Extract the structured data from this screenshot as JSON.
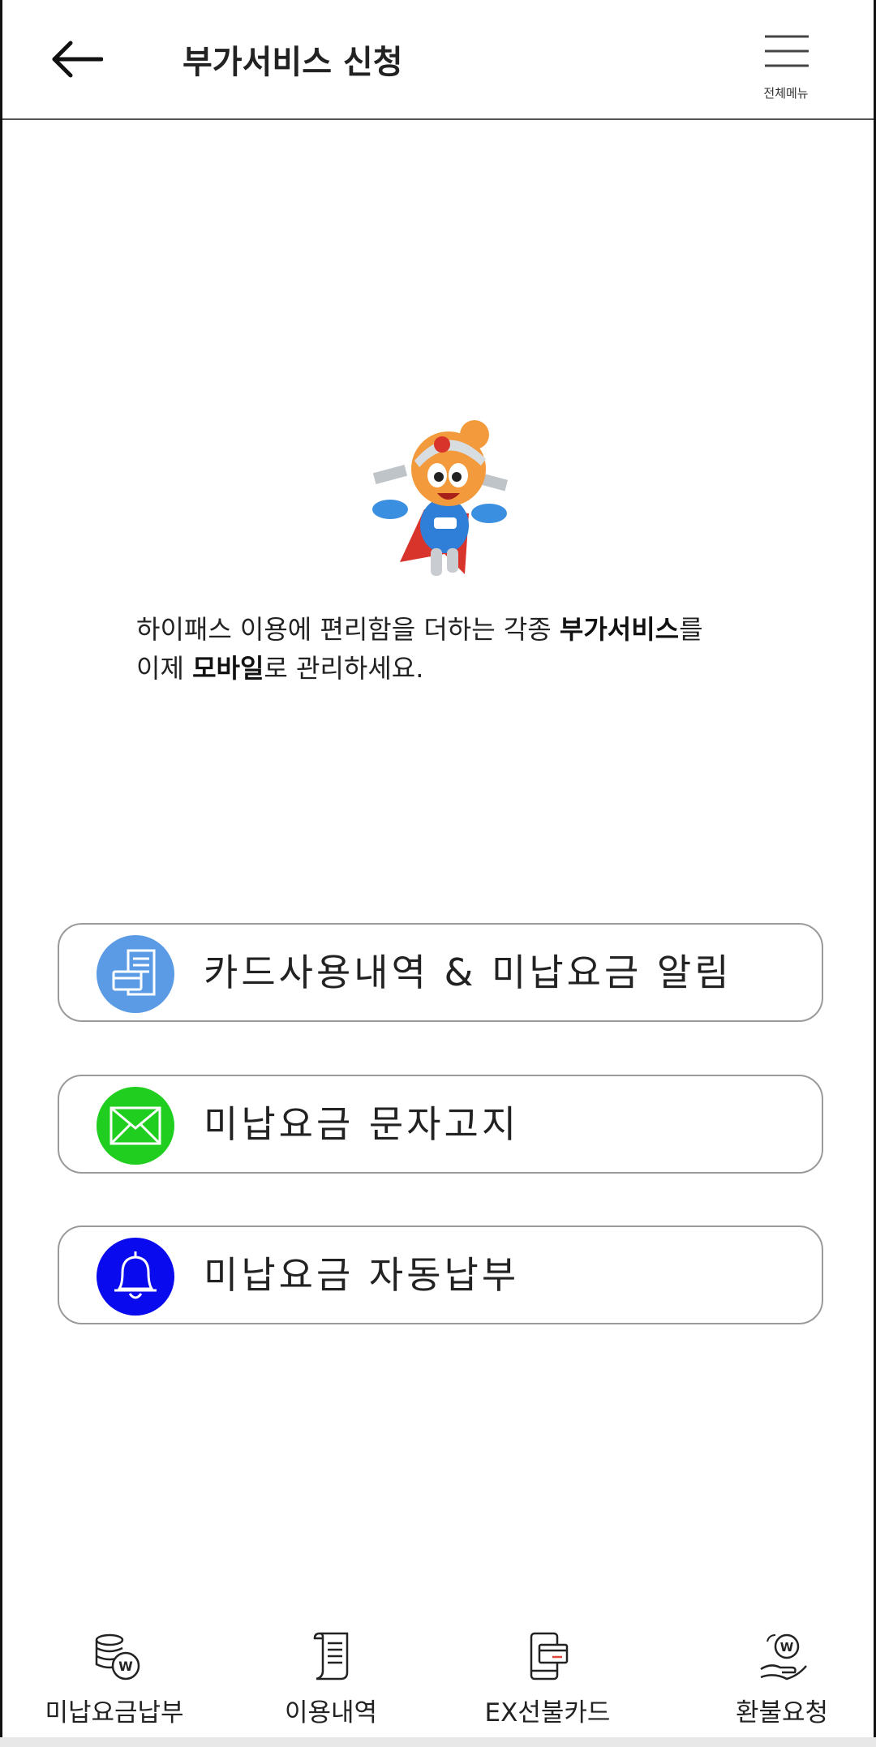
{
  "header": {
    "title": "부가서비스 신청",
    "menu_label": "전체메뉴"
  },
  "intro": {
    "line1_prefix": "하이패스 이용에 편리함을 더하는 각종 ",
    "line1_bold": "부가서비스",
    "line1_suffix": "를",
    "line2_prefix": "이제 ",
    "line2_bold": "모바일",
    "line2_suffix": "로 관리하세요."
  },
  "services": [
    {
      "label": "카드사용내역 & 미납요금 알림",
      "icon": "card-receipt-icon",
      "color": "#5b9be6"
    },
    {
      "label": "미납요금 문자고지",
      "icon": "envelope-icon",
      "color": "#1fce1f"
    },
    {
      "label": "미납요금 자동납부",
      "icon": "bell-icon",
      "color": "#0a0aee"
    }
  ],
  "bottom_nav": [
    {
      "label": "미납요금납부",
      "icon": "coins-icon"
    },
    {
      "label": "이용내역",
      "icon": "receipt-icon"
    },
    {
      "label": "EX선불카드",
      "icon": "prepaid-card-icon"
    },
    {
      "label": "환불요청",
      "icon": "refund-hand-icon"
    }
  ]
}
